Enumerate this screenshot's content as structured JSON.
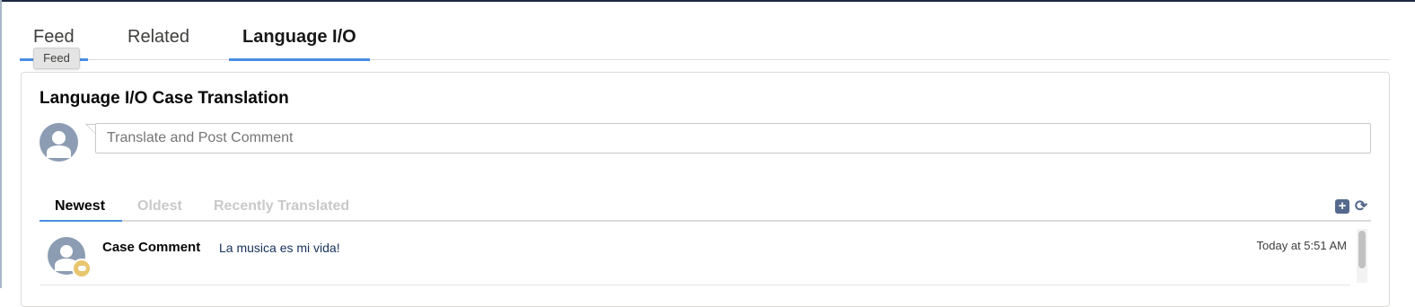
{
  "tabs": [
    {
      "label": "Feed"
    },
    {
      "label": "Related"
    },
    {
      "label": "Language I/O"
    }
  ],
  "tooltip": "Feed",
  "card": {
    "title": "Language I/O Case Translation",
    "comment_placeholder": "Translate and Post Comment"
  },
  "sort_tabs": [
    {
      "label": "Newest"
    },
    {
      "label": "Oldest"
    },
    {
      "label": "Recently Translated"
    }
  ],
  "icons": {
    "add": "plus-square-icon",
    "refresh": "refresh-icon"
  },
  "feed": [
    {
      "author": "Case Comment",
      "text": "La musica es mi vida!",
      "time": "Today at 5:51 AM"
    }
  ],
  "colors": {
    "accent": "#4a8ee4",
    "avatar": "#8c9db3",
    "badge": "#e8c66f",
    "link_text": "#16325c"
  }
}
